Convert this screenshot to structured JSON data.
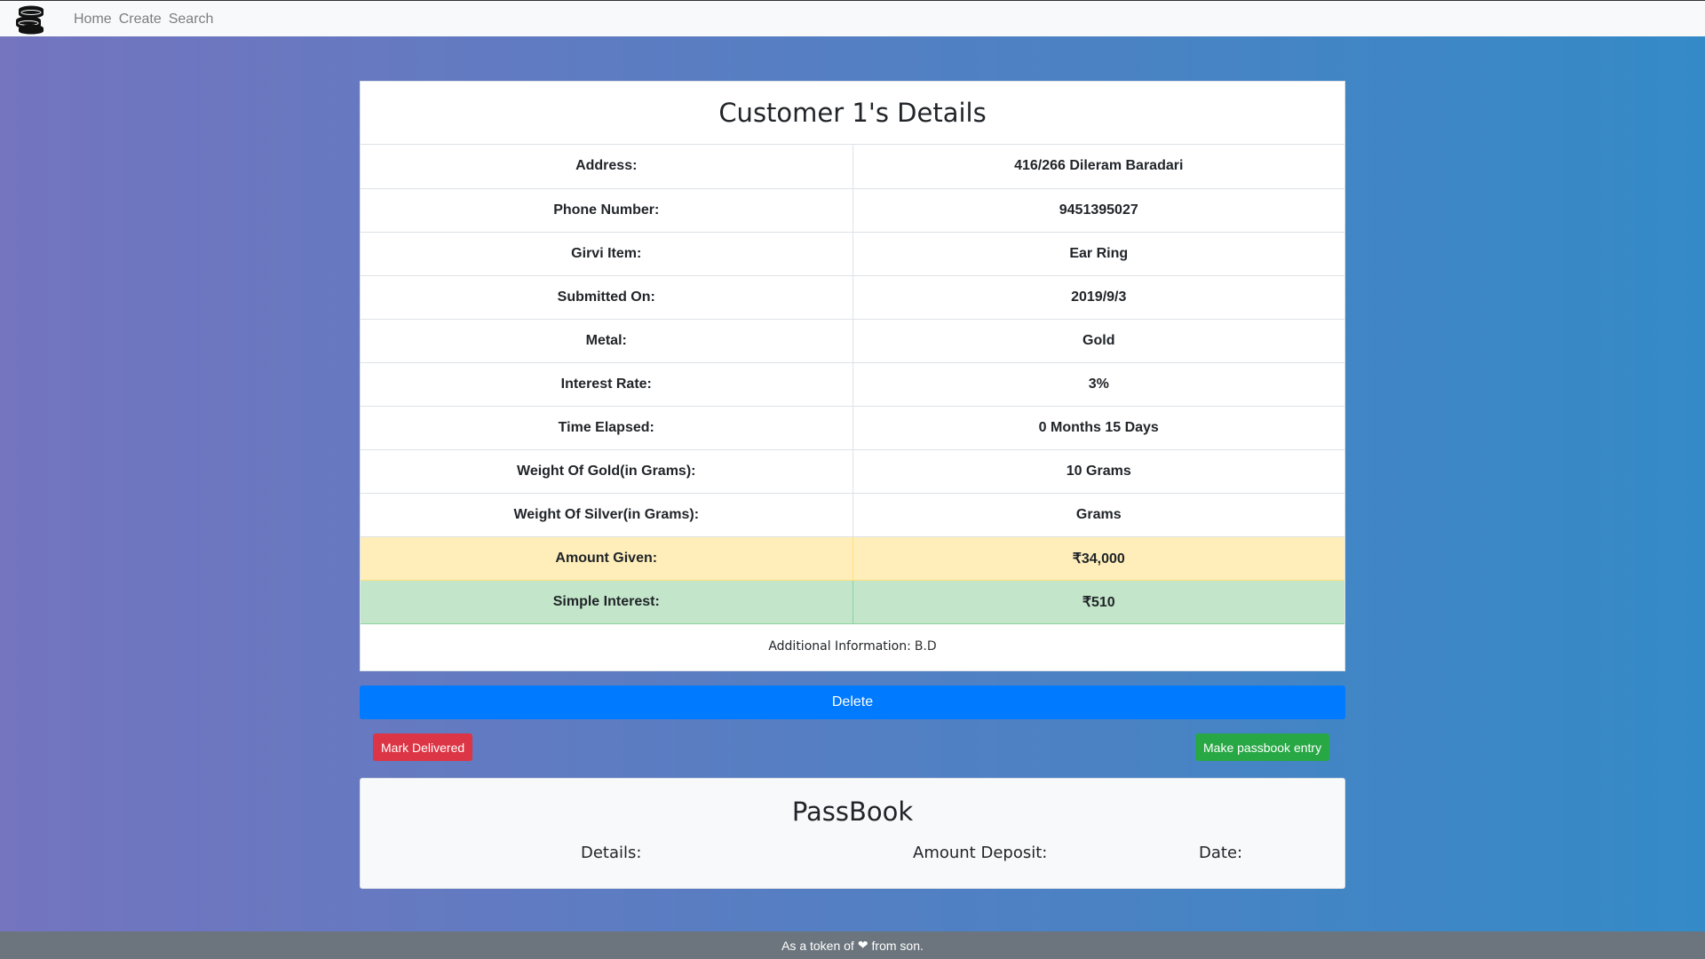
{
  "nav": {
    "logo_icon": "coins-stack-icon",
    "links": [
      {
        "label": "Home"
      },
      {
        "label": "Create"
      },
      {
        "label": "Search"
      }
    ]
  },
  "customer": {
    "title": "Customer 1's Details",
    "rows": [
      {
        "label": "Address:",
        "value": "416/266 Dileram Baradari"
      },
      {
        "label": "Phone Number:",
        "value": "9451395027"
      },
      {
        "label": "Girvi Item:",
        "value": "Ear Ring"
      },
      {
        "label": "Submitted On:",
        "value": "2019/9/3"
      },
      {
        "label": "Metal:",
        "value": "Gold"
      },
      {
        "label": "Interest Rate:",
        "value": "3%"
      },
      {
        "label": "Time Elapsed:",
        "value": "0 Months 15 Days"
      },
      {
        "label": "Weight Of Gold(in Grams):",
        "value": "10 Grams"
      },
      {
        "label": "Weight Of Silver(in Grams):",
        "value": "Grams"
      },
      {
        "label": "Amount Given:",
        "value": "₹34,000"
      },
      {
        "label": "Simple Interest:",
        "value": "₹510"
      }
    ],
    "additional_label": "Additional Information:",
    "additional_value": "B.D"
  },
  "actions": {
    "delete_label": "Delete",
    "mark_delivered_label": "Mark Delivered",
    "passbook_entry_label": "Make passbook entry"
  },
  "passbook": {
    "title": "PassBook",
    "col_details": "Details:",
    "col_amount": "Amount Deposit:",
    "col_date": "Date:"
  },
  "footer": {
    "text_before": "As a token of",
    "heart": "❤",
    "text_after": "from son."
  },
  "colors": {
    "warning_row": "#ffeeba",
    "success_row": "#c3e6cb",
    "primary": "#007bff",
    "danger": "#dc3545",
    "success": "#28a745"
  }
}
